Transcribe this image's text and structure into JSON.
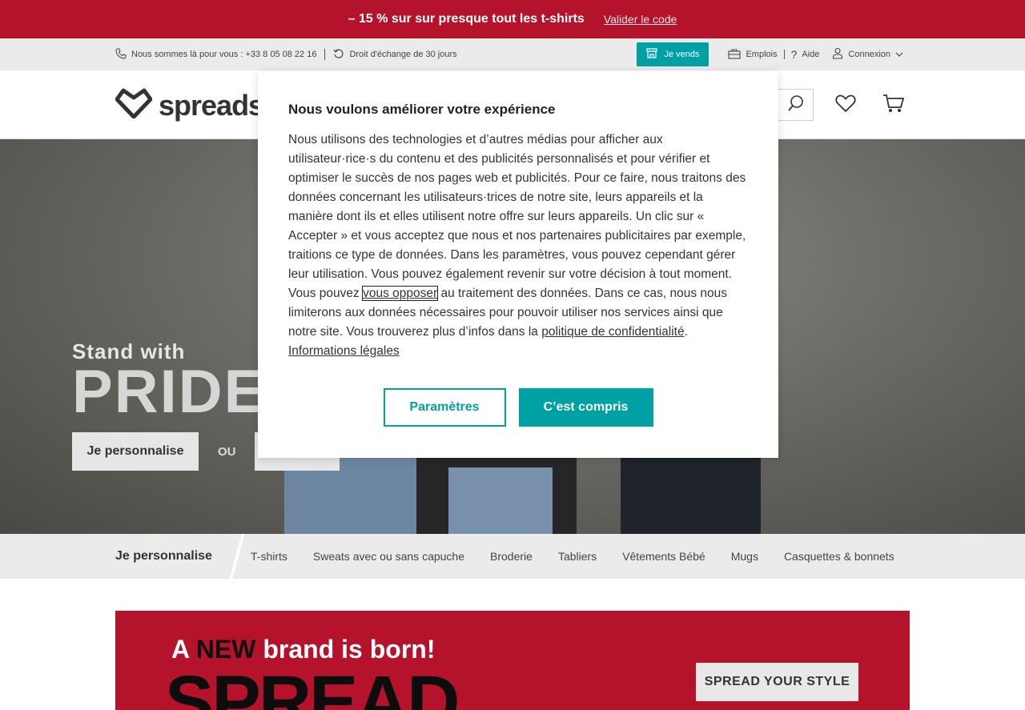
{
  "promo": {
    "text": "– 15 % sur sur presque tout les t-shirts",
    "link": "Valider le code"
  },
  "utility": {
    "phone": "Nous sommes là pour vous : +33 8 05 08 22 16",
    "exchange": "Droit d'échange de 30 jours",
    "sell": "Je vends",
    "jobs": "Emplois",
    "help": "Aide",
    "login": "Connexion"
  },
  "header": {
    "logo": "spreadshirt"
  },
  "hero": {
    "subtitle": "Stand with",
    "title": "PRIDE",
    "btn_personalize": "Je personnalise",
    "or": "OU"
  },
  "categories": {
    "heading": "Je personnalise",
    "items": [
      "T-shirts",
      "Sweats avec ou sans capuche",
      "Broderie",
      "Tabliers",
      "Vêtements Bébé",
      "Mugs",
      "Casquettes & bonnets"
    ]
  },
  "banner": {
    "headline_pre": "A ",
    "headline_new": "NEW",
    "headline_post": " brand is born!",
    "brand": "SPREAD",
    "cta": "SPREAD YOUR STYLE"
  },
  "modal": {
    "title": "Nous voulons améliorer votre expérience",
    "body_1": "Nous utilisons des technologies et d’autres médias pour afficher aux utilisateur·rice·s du contenu et des publicités personnalisés et pour vérifier et optimiser le succès de nos pages web et publicités. Pour ce faire, nous traitons des données concernant les utilisateurs·trices de notre site, leurs appareils et la manière dont ils et elles utilisent notre offre sur leurs appareils. Un clic sur « Accepter » et vous acceptez que nous et nos partenaires publicitaires par exemple, traitions ce type de données. Dans les paramètres, vous pouvez cependant gérer leur utilisation. Vous pouvez également revenir sur votre décision à tout moment. Vous pouvez ",
    "link_oppose": "vous opposer",
    "body_2": " au traitement des données. Dans ce cas, nous nous limiterons aux données nécessaires pour pouvoir utiliser nos services ainsi que notre site. Vous trouverez plus d’infos dans la ",
    "link_privacy": "politique de confidentialité",
    "body_3": ". ",
    "link_legal": "Informations légales",
    "btn_settings": "Paramètres",
    "btn_accept": "C’est compris"
  },
  "colors": {
    "brand_red": "#b5122b",
    "teal": "#00a1a4"
  }
}
